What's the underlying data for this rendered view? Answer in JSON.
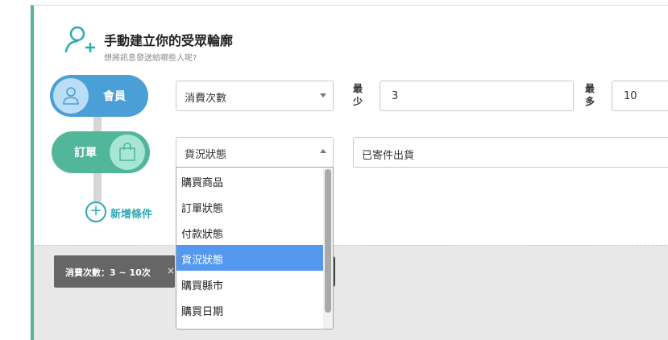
{
  "header": {
    "title": "手動建立你的受眾輪廓",
    "subtitle": "想將訊息發送給哪些人呢?"
  },
  "conditions": [
    {
      "category": "會員",
      "field": "消費次數",
      "min_label": "最少",
      "min_value": "3",
      "max_label": "最多",
      "max_value": "10"
    },
    {
      "category": "訂單",
      "field": "貨況狀態",
      "value": "已寄件出貨"
    }
  ],
  "add_condition_label": "新增條件",
  "tag": {
    "text": "消費次數：3 ~ 10次",
    "close_icon": "×"
  },
  "dropdown": {
    "options": [
      "購買商品",
      "訂單狀態",
      "付款狀態",
      "貨況狀態",
      "購買縣市",
      "購買日期"
    ],
    "selected": "貨況狀態"
  },
  "colors": {
    "member": "#4a9fd6",
    "order": "#52b69a",
    "accent": "#2ea9b3",
    "selected_option": "#5598f0"
  },
  "icons": [
    "add-person-icon",
    "user-icon",
    "shopping-bag-icon",
    "plus-circle-icon",
    "close-icon"
  ]
}
